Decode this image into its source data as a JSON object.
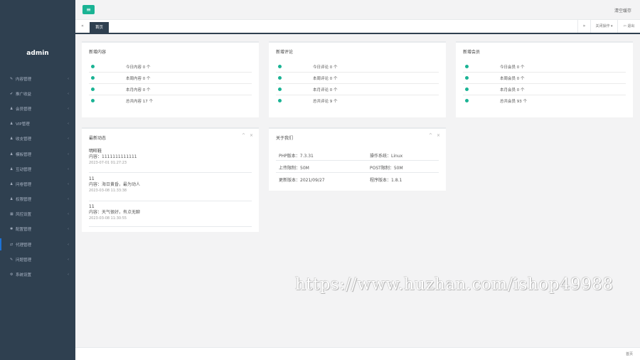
{
  "sidebar": {
    "brand": "admin",
    "items": [
      {
        "icon": "✎",
        "label": "内容管理",
        "arrow": "‹"
      },
      {
        "icon": "✔",
        "label": "推广收益",
        "arrow": "‹"
      },
      {
        "icon": "♟",
        "label": "会员管理",
        "arrow": "‹"
      },
      {
        "icon": "♟",
        "label": "VIP管理",
        "arrow": "‹"
      },
      {
        "icon": "♟",
        "label": "收支管理",
        "arrow": "‹"
      },
      {
        "icon": "♟",
        "label": "模板管理",
        "arrow": "‹"
      },
      {
        "icon": "♟",
        "label": "互动管理",
        "arrow": "‹"
      },
      {
        "icon": "♟",
        "label": "问卷管理",
        "arrow": "‹"
      },
      {
        "icon": "♟",
        "label": "权限管理",
        "arrow": "‹"
      },
      {
        "icon": "▦",
        "label": "风控设置",
        "arrow": "‹"
      },
      {
        "icon": "✱",
        "label": "配置管理",
        "arrow": "‹"
      },
      {
        "icon": "⇄",
        "label": "代理管理",
        "arrow": "‹"
      },
      {
        "icon": "✎",
        "label": "问题管理",
        "arrow": "‹"
      },
      {
        "icon": "⚙",
        "label": "系统设置",
        "arrow": "‹"
      }
    ]
  },
  "topbar": {
    "toggle_icon": "≡",
    "clear_cache": "清空缓存"
  },
  "tabbar": {
    "prev_icon": "«",
    "home_tab": "首页",
    "next_icon": "»",
    "close_ops": "关闭操作 ▾",
    "exit": "⇦ 退出"
  },
  "stats": {
    "content": {
      "title": "新增内容",
      "rows": [
        "今日内容 0 个",
        "本周内容 0 个",
        "本月内容 0 个",
        "总共内容 17 个"
      ]
    },
    "comments": {
      "title": "新增评论",
      "rows": [
        "今日评论 0 个",
        "本周评论 0 个",
        "本月评论 0 个",
        "总共评论 9 个"
      ]
    },
    "members": {
      "title": "新增会员",
      "rows": [
        "今日会员 0 个",
        "本周会员 0 个",
        "本月会员 0 个",
        "总共会员 93 个"
      ]
    }
  },
  "news": {
    "title": "最新动态",
    "tools": [
      "^",
      "×"
    ],
    "items": [
      {
        "author": "明旺鞋",
        "content": "内容：1111111111111",
        "time": "2023-07-01 01:27:23"
      },
      {
        "author": "11",
        "content": "内容：海日黄昏，最为动人",
        "time": "2023-03-08 11:33:38"
      },
      {
        "author": "11",
        "content": "内容：天气很好，有点无聊",
        "time": "2023-03-08 11:30:55"
      }
    ]
  },
  "about": {
    "title": "关于我们",
    "tools": [
      "^",
      "×"
    ],
    "rows": [
      {
        "left": "PHP版本：7.3.31",
        "right": "操作系统：Linux"
      },
      {
        "left": "上传限制：50M",
        "right": "POST限制：50M"
      },
      {
        "left": "更新版本：2021/09/27",
        "right": "程序版本：1.8.1"
      }
    ]
  },
  "watermark": "https://www.huzhan.com/ishop49988",
  "footer": {
    "text": "首页"
  }
}
